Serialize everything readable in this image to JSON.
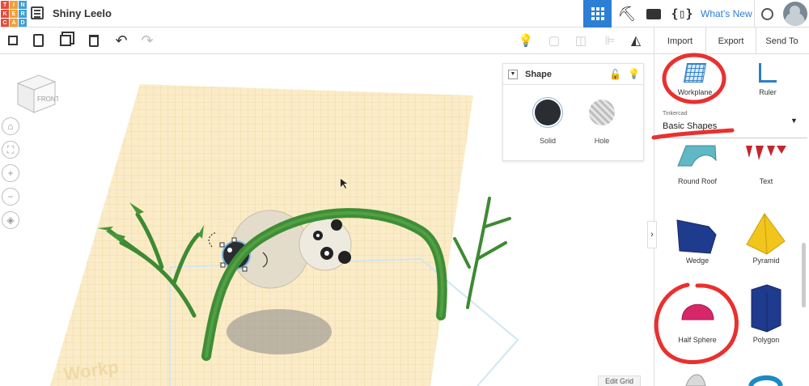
{
  "app": {
    "logo_letters": [
      "T",
      "I",
      "N",
      "K",
      "E",
      "R",
      "C",
      "A",
      "D"
    ],
    "logo_colors": [
      "#e94b3c",
      "#f29d38",
      "#3f9fd8",
      "#e94b3c",
      "#f29d38",
      "#3f9fd8",
      "#e94b3c",
      "#f29d38",
      "#3f9fd8"
    ],
    "document_title": "Shiny Leelo",
    "whats_new": "What's New",
    "accent_color": "#2c7fd4"
  },
  "header_icons": [
    "design-grid-icon",
    "pickaxe-icon",
    "bricks-icon",
    "codeblocks-icon",
    "add-user-icon",
    "avatar"
  ],
  "toolbar": {
    "right_buttons": {
      "import": "Import",
      "export": "Export",
      "send_to": "Send To"
    }
  },
  "canvas": {
    "viewcube_face": "FRONT",
    "workplane_watermark": "Workp"
  },
  "shape_panel": {
    "title": "Shape",
    "solid_label": "Solid",
    "hole_label": "Hole"
  },
  "edit_grid": "Edit Grid",
  "right_panel": {
    "tools": [
      {
        "label": "Workplane",
        "icon": "workplane-icon"
      },
      {
        "label": "Ruler",
        "icon": "ruler-icon"
      }
    ],
    "category_source": "Tinkercad",
    "category_selected": "Basic Shapes",
    "shapes": [
      {
        "label": "Round Roof",
        "color": "#5fb8c4"
      },
      {
        "label": "Text",
        "color": "#c0282d"
      },
      {
        "label": "Wedge",
        "color": "#1f3b8e"
      },
      {
        "label": "Pyramid",
        "color": "#f1c51c"
      },
      {
        "label": "Half Sphere",
        "color": "#d8266b"
      },
      {
        "label": "Polygon",
        "color": "#1f3b8e"
      }
    ]
  },
  "annotation_color": "#e8312f"
}
